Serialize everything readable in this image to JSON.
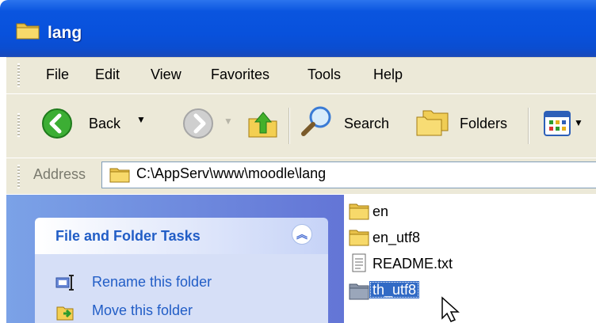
{
  "window": {
    "title": "lang"
  },
  "menu": {
    "items": [
      "File",
      "Edit",
      "View",
      "Favorites",
      "Tools",
      "Help"
    ]
  },
  "toolbar": {
    "back_label": "Back",
    "search_label": "Search",
    "folders_label": "Folders"
  },
  "address": {
    "label": "Address",
    "path": "C:\\AppServ\\www\\moodle\\lang"
  },
  "tasks": {
    "title": "File and Folder Tasks",
    "items": [
      "Rename this folder",
      "Move this folder"
    ]
  },
  "files": [
    {
      "name": "en",
      "type": "folder"
    },
    {
      "name": "en_utf8",
      "type": "folder"
    },
    {
      "name": "README.txt",
      "type": "text-file"
    },
    {
      "name": "th_utf8",
      "type": "folder",
      "selected": true
    }
  ],
  "colors": {
    "title_bar": "#0851dc",
    "task_link": "#215dc6",
    "selection": "#316ac5",
    "chrome": "#ece9d8"
  }
}
